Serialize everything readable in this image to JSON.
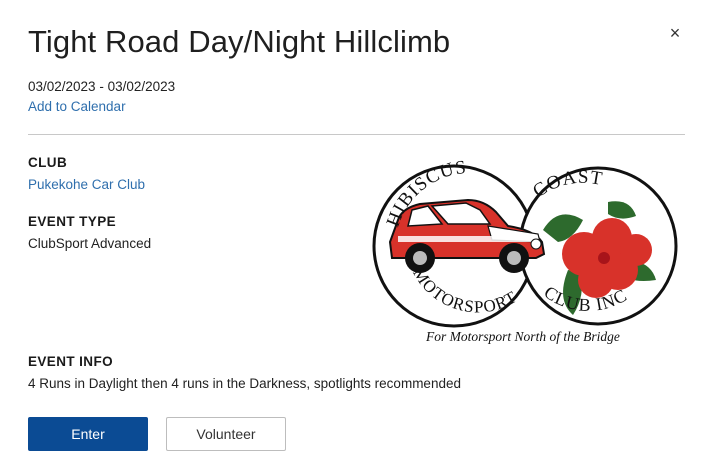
{
  "event": {
    "title": "Tight Road Day/Night Hillclimb",
    "dates": "03/02/2023 - 03/02/2023",
    "add_to_calendar": "Add to Calendar",
    "close_glyph": "×"
  },
  "details": {
    "club_label": "CLUB",
    "club_value": "Pukekohe Car Club",
    "type_label": "EVENT TYPE",
    "type_value": "ClubSport Advanced",
    "info_label": "EVENT INFO",
    "info_value": "4 Runs in Daylight then 4 runs in the Darkness, spotlights recommended"
  },
  "logo": {
    "top_left": "HIBISCUS",
    "top_right": "COAST",
    "bottom_left": "MOTORSPORT",
    "bottom_right": "CLUB INC",
    "tagline": "For Motorsport North of the Bridge",
    "accent_color": "#d8322a",
    "leaf_color": "#2d6a2d"
  },
  "actions": {
    "enter_label": "Enter",
    "volunteer_label": "Volunteer",
    "primary_color": "#0b4b94"
  }
}
